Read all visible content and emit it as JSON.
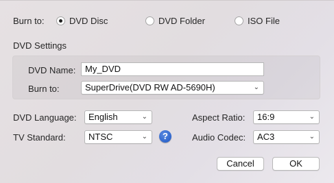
{
  "burn_to": {
    "label": "Burn to:",
    "options": [
      {
        "label": "DVD Disc",
        "selected": true
      },
      {
        "label": "DVD Folder",
        "selected": false
      },
      {
        "label": "ISO File",
        "selected": false
      }
    ]
  },
  "dvd_settings": {
    "title": "DVD Settings",
    "dvd_name_label": "DVD Name:",
    "dvd_name_value": "My_DVD",
    "burn_to_label": "Burn to:",
    "burn_to_value": "SuperDrive(DVD RW AD-5690H)"
  },
  "dvd_language": {
    "label": "DVD Language:",
    "value": "English"
  },
  "tv_standard": {
    "label": "TV Standard:",
    "value": "NTSC"
  },
  "aspect_ratio": {
    "label": "Aspect Ratio:",
    "value": "16:9"
  },
  "audio_codec": {
    "label": "Audio Codec:",
    "value": "AC3"
  },
  "help_icon": "?",
  "buttons": {
    "cancel": "Cancel",
    "ok": "OK"
  },
  "icons": {
    "chevron": "chevron-down-icon",
    "help": "question-mark-icon"
  },
  "colors": {
    "help_blue": "#1d56c4",
    "background": "#e4dfe2"
  }
}
